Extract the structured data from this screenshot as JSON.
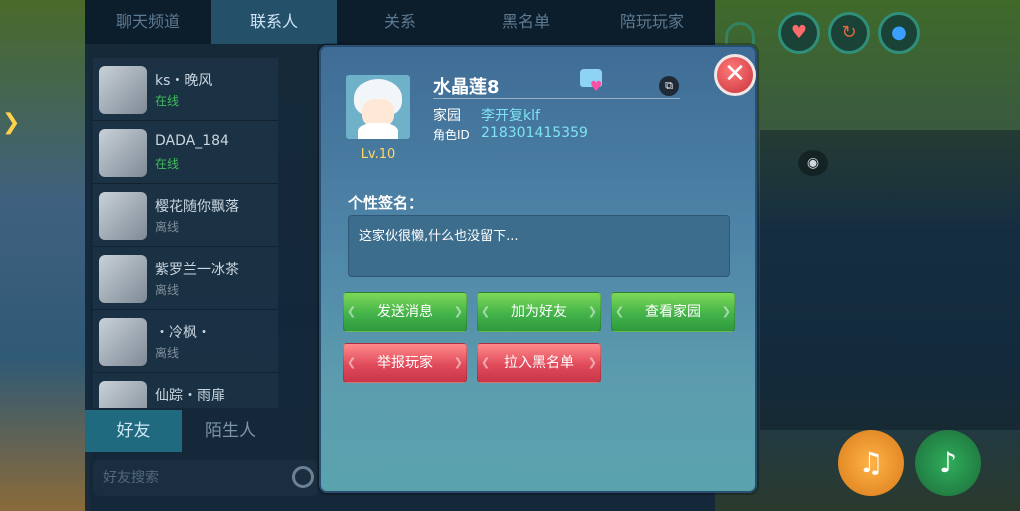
{
  "social": {
    "tabs": [
      "聊天频道",
      "联系人",
      "关系",
      "黑名单",
      "陪玩玩家"
    ],
    "contacts": [
      {
        "name": "ks・晚风",
        "status": "在线"
      },
      {
        "name": "DADA_184",
        "status": "在线"
      },
      {
        "name": "樱花随你飘落",
        "status": "离线"
      },
      {
        "name": "紫罗兰一冰茶",
        "status": "离线"
      },
      {
        "name": "・冷枫・",
        "status": "离线"
      },
      {
        "name": "仙踪・雨扉",
        "status": ""
      }
    ],
    "list_tabs": {
      "friends": "好友",
      "strangers": "陌生人"
    },
    "search_placeholder": "好友搜索"
  },
  "profile": {
    "name": "水晶莲8",
    "level": "Lv.10",
    "home_label": "家园",
    "home_value": "李开复klf",
    "id_label": "角色ID",
    "id_value": "218301415359",
    "signature_title": "个性签名：",
    "signature_text": "这家伙很懒,什么也没留下..."
  },
  "actions": {
    "send_message": "发送消息",
    "add_friend": "加为好友",
    "view_home": "查看家园",
    "report": "举报玩家",
    "blacklist": "拉入黑名单",
    "close": "✕"
  },
  "colors": {
    "dialog_top": "#3f6c96",
    "dialog_bottom": "#5aa3ad",
    "green_button": "#43b34a",
    "red_button": "#e04b5b",
    "id_value": "#7fe3f2",
    "level": "#ffd966"
  },
  "icons": [
    "close-icon",
    "copy-icon",
    "outfit-icon",
    "search-icon",
    "heart-icon",
    "horn-icon",
    "eye-icon"
  ]
}
